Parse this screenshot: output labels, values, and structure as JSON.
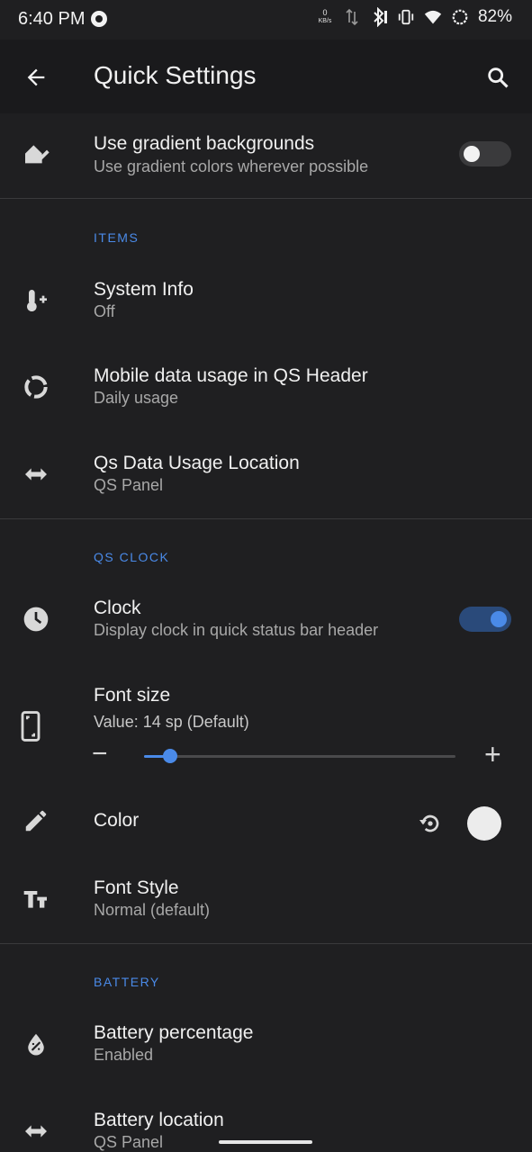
{
  "status_bar": {
    "time": "6:40 PM",
    "net_speed_value": "0",
    "net_speed_unit": "KB/s",
    "battery": "82%"
  },
  "app_bar": {
    "title": "Quick Settings"
  },
  "gradient": {
    "title": "Use gradient backgrounds",
    "subtitle": "Use gradient colors wherever possible",
    "enabled": false
  },
  "sections": {
    "items": "ITEMS",
    "qs_clock": "QS CLOCK",
    "battery": "BATTERY"
  },
  "items": [
    {
      "title": "System Info",
      "subtitle": "Off",
      "icon": "thermometer-plus-icon"
    },
    {
      "title": "Mobile data usage in QS Header",
      "subtitle": "Daily usage",
      "icon": "data-usage-icon"
    },
    {
      "title": "Qs Data Usage Location",
      "subtitle": "QS Panel",
      "icon": "swap-horiz-icon"
    }
  ],
  "clock": {
    "title": "Clock",
    "subtitle": "Display clock in quick status bar header",
    "enabled": true
  },
  "font_size": {
    "title": "Font size",
    "value_text": "Value: 14 sp (Default)",
    "minus": "−",
    "plus": "+",
    "slider_fraction": 0.085
  },
  "color": {
    "title": "Color",
    "swatch": "#ececec"
  },
  "font_style": {
    "title": "Font Style",
    "subtitle": "Normal (default)"
  },
  "battery_items": [
    {
      "title": "Battery percentage",
      "subtitle": "Enabled",
      "icon": "battery-drop-icon"
    },
    {
      "title": "Battery location",
      "subtitle": "QS Panel",
      "icon": "swap-horiz-icon"
    }
  ],
  "colors": {
    "accent": "#4a8ae8",
    "background": "#1f1f21",
    "toggle_on_track": "#2a4a7a"
  }
}
